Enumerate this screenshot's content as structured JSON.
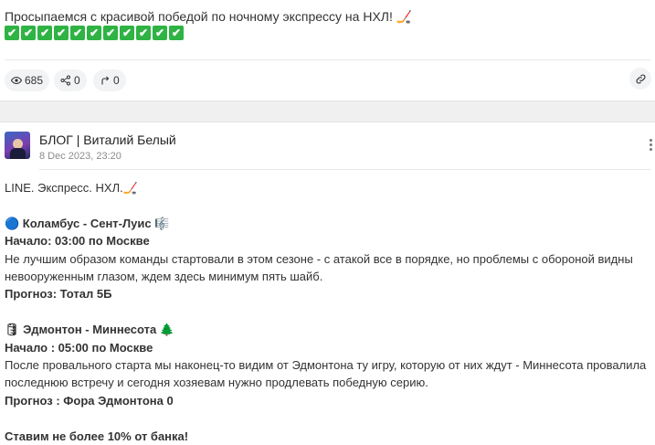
{
  "post1": {
    "text": "Просыпаемся с красивой победой по ночному экспрессу на НХЛ! 🏒",
    "checks": [
      "✔",
      "✔",
      "✔",
      "✔",
      "✔",
      "✔",
      "✔",
      "✔",
      "✔",
      "✔",
      "✔"
    ],
    "views": "685",
    "shares": "0",
    "reposts": "0"
  },
  "post2": {
    "author": "БЛОГ | Виталий Белый",
    "date": "8 Dec 2023, 23:20",
    "heading": "LINE. Экспресс. НХЛ.🏒",
    "match1_title": "🔵 Коламбус - Сент-Луис 🎼",
    "match1_start": "Начало: 03:00 по Москве",
    "match1_text": "Не лучшим образом команды стартовали в этом сезоне - с атакой все в порядке, но проблемы с обороной видны невооруженным глазом, ждем здесь минимум пять шайб.",
    "match1_pick": "Прогноз: Тотал 5Б",
    "match2_title": "🛢 Эдмонтон - Миннесота 🌲",
    "match2_start": "Начало : 05:00 по Москве",
    "match2_text": "После провального старта мы наконец-то видим от Эдмонтона ту игру, которую от них ждут - Миннесота провалила последнюю встречу и сегодня хозяевам нужно продлевать победную серию.",
    "match2_pick": "Прогноз : Фора Эдмонтона 0",
    "footer": "Ставим не более 10% от банка!"
  },
  "colors": {
    "check_green": "#2fb344",
    "pill_bg": "#f1f3f5",
    "separator_bg": "#f0f0f0"
  }
}
